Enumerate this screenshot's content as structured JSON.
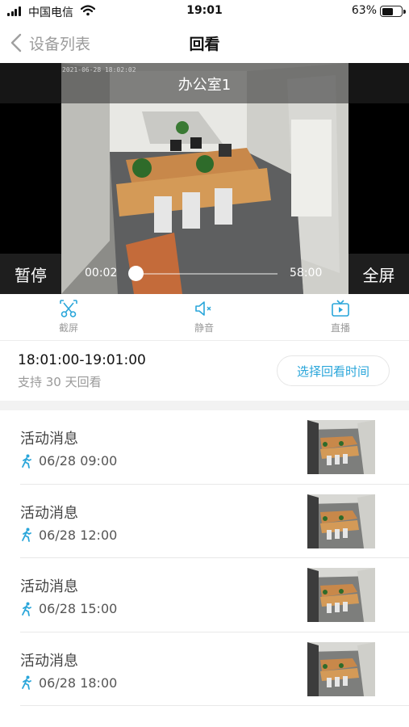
{
  "status_bar": {
    "carrier": "中国电信",
    "time": "19:01",
    "battery_percent": "63%",
    "battery_level": 0.63
  },
  "nav": {
    "back_label": "设备列表",
    "title": "回看"
  },
  "player": {
    "timestamp": "2021-06-28 18:02:02",
    "camera_name": "办公室1",
    "pause_label": "暂停",
    "fullscreen_label": "全屏",
    "current_time": "00:02",
    "duration": "58:00",
    "progress": 0.0
  },
  "toolbar": {
    "screenshot_label": "截屏",
    "mute_label": "静音",
    "live_label": "直播"
  },
  "playback_range": {
    "span": "18:01:00-19:01:00",
    "hint": "支持 30 天回看",
    "select_button": "选择回看时间"
  },
  "events": [
    {
      "title": "活动消息",
      "time": "06/28 09:00"
    },
    {
      "title": "活动消息",
      "time": "06/28 12:00"
    },
    {
      "title": "活动消息",
      "time": "06/28 15:00"
    },
    {
      "title": "活动消息",
      "time": "06/28 18:00"
    }
  ],
  "colors": {
    "accent": "#2aa6da",
    "secondary_text": "#9b9b9b"
  }
}
